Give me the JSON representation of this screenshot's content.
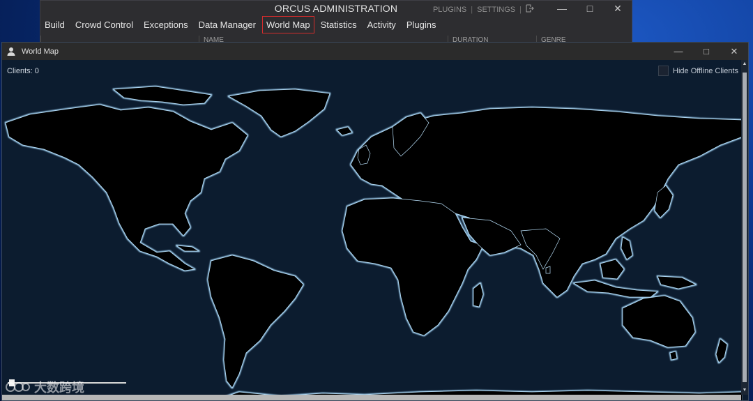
{
  "admin": {
    "title": "ORCUS ADMINISTRATION",
    "links": [
      "PLUGINS",
      "SETTINGS"
    ],
    "nav": [
      "Build",
      "Crowd Control",
      "Exceptions",
      "Data Manager",
      "World Map",
      "Statistics",
      "Activity",
      "Plugins"
    ],
    "active_nav": "World Map",
    "columns": [
      "NAME",
      "DURATION",
      "GENRE"
    ]
  },
  "map_window": {
    "title": "World Map",
    "clients_label": "Clients:",
    "clients_count": "0",
    "hide_offline_label": "Hide Offline Clients",
    "hide_offline_checked": false
  },
  "watermark": "大数跨境",
  "colors": {
    "accent_active": "#d42c2c",
    "map_ocean": "#0c1c2f",
    "map_land": "#000000",
    "coast_glow": "#8fc8f0"
  },
  "icons": {
    "window": "person-icon",
    "logout": "logout-icon"
  }
}
